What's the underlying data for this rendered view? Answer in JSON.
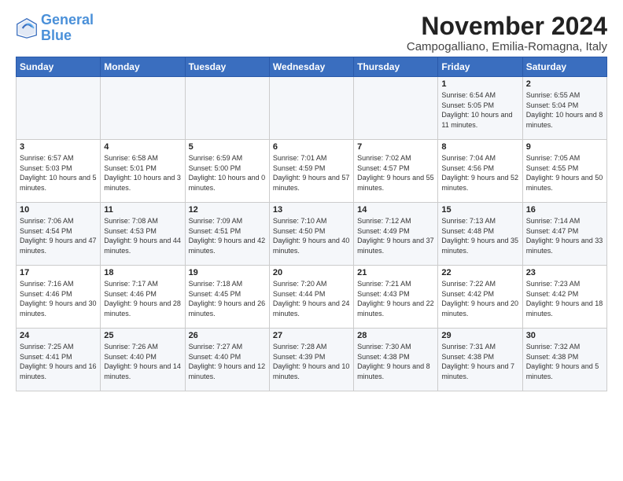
{
  "logo": {
    "text1": "General",
    "text2": "Blue"
  },
  "title": "November 2024",
  "subtitle": "Campogalliano, Emilia-Romagna, Italy",
  "days_of_week": [
    "Sunday",
    "Monday",
    "Tuesday",
    "Wednesday",
    "Thursday",
    "Friday",
    "Saturday"
  ],
  "weeks": [
    [
      {
        "day": "",
        "info": ""
      },
      {
        "day": "",
        "info": ""
      },
      {
        "day": "",
        "info": ""
      },
      {
        "day": "",
        "info": ""
      },
      {
        "day": "",
        "info": ""
      },
      {
        "day": "1",
        "info": "Sunrise: 6:54 AM\nSunset: 5:05 PM\nDaylight: 10 hours and 11 minutes."
      },
      {
        "day": "2",
        "info": "Sunrise: 6:55 AM\nSunset: 5:04 PM\nDaylight: 10 hours and 8 minutes."
      }
    ],
    [
      {
        "day": "3",
        "info": "Sunrise: 6:57 AM\nSunset: 5:03 PM\nDaylight: 10 hours and 5 minutes."
      },
      {
        "day": "4",
        "info": "Sunrise: 6:58 AM\nSunset: 5:01 PM\nDaylight: 10 hours and 3 minutes."
      },
      {
        "day": "5",
        "info": "Sunrise: 6:59 AM\nSunset: 5:00 PM\nDaylight: 10 hours and 0 minutes."
      },
      {
        "day": "6",
        "info": "Sunrise: 7:01 AM\nSunset: 4:59 PM\nDaylight: 9 hours and 57 minutes."
      },
      {
        "day": "7",
        "info": "Sunrise: 7:02 AM\nSunset: 4:57 PM\nDaylight: 9 hours and 55 minutes."
      },
      {
        "day": "8",
        "info": "Sunrise: 7:04 AM\nSunset: 4:56 PM\nDaylight: 9 hours and 52 minutes."
      },
      {
        "day": "9",
        "info": "Sunrise: 7:05 AM\nSunset: 4:55 PM\nDaylight: 9 hours and 50 minutes."
      }
    ],
    [
      {
        "day": "10",
        "info": "Sunrise: 7:06 AM\nSunset: 4:54 PM\nDaylight: 9 hours and 47 minutes."
      },
      {
        "day": "11",
        "info": "Sunrise: 7:08 AM\nSunset: 4:53 PM\nDaylight: 9 hours and 44 minutes."
      },
      {
        "day": "12",
        "info": "Sunrise: 7:09 AM\nSunset: 4:51 PM\nDaylight: 9 hours and 42 minutes."
      },
      {
        "day": "13",
        "info": "Sunrise: 7:10 AM\nSunset: 4:50 PM\nDaylight: 9 hours and 40 minutes."
      },
      {
        "day": "14",
        "info": "Sunrise: 7:12 AM\nSunset: 4:49 PM\nDaylight: 9 hours and 37 minutes."
      },
      {
        "day": "15",
        "info": "Sunrise: 7:13 AM\nSunset: 4:48 PM\nDaylight: 9 hours and 35 minutes."
      },
      {
        "day": "16",
        "info": "Sunrise: 7:14 AM\nSunset: 4:47 PM\nDaylight: 9 hours and 33 minutes."
      }
    ],
    [
      {
        "day": "17",
        "info": "Sunrise: 7:16 AM\nSunset: 4:46 PM\nDaylight: 9 hours and 30 minutes."
      },
      {
        "day": "18",
        "info": "Sunrise: 7:17 AM\nSunset: 4:46 PM\nDaylight: 9 hours and 28 minutes."
      },
      {
        "day": "19",
        "info": "Sunrise: 7:18 AM\nSunset: 4:45 PM\nDaylight: 9 hours and 26 minutes."
      },
      {
        "day": "20",
        "info": "Sunrise: 7:20 AM\nSunset: 4:44 PM\nDaylight: 9 hours and 24 minutes."
      },
      {
        "day": "21",
        "info": "Sunrise: 7:21 AM\nSunset: 4:43 PM\nDaylight: 9 hours and 22 minutes."
      },
      {
        "day": "22",
        "info": "Sunrise: 7:22 AM\nSunset: 4:42 PM\nDaylight: 9 hours and 20 minutes."
      },
      {
        "day": "23",
        "info": "Sunrise: 7:23 AM\nSunset: 4:42 PM\nDaylight: 9 hours and 18 minutes."
      }
    ],
    [
      {
        "day": "24",
        "info": "Sunrise: 7:25 AM\nSunset: 4:41 PM\nDaylight: 9 hours and 16 minutes."
      },
      {
        "day": "25",
        "info": "Sunrise: 7:26 AM\nSunset: 4:40 PM\nDaylight: 9 hours and 14 minutes."
      },
      {
        "day": "26",
        "info": "Sunrise: 7:27 AM\nSunset: 4:40 PM\nDaylight: 9 hours and 12 minutes."
      },
      {
        "day": "27",
        "info": "Sunrise: 7:28 AM\nSunset: 4:39 PM\nDaylight: 9 hours and 10 minutes."
      },
      {
        "day": "28",
        "info": "Sunrise: 7:30 AM\nSunset: 4:38 PM\nDaylight: 9 hours and 8 minutes."
      },
      {
        "day": "29",
        "info": "Sunrise: 7:31 AM\nSunset: 4:38 PM\nDaylight: 9 hours and 7 minutes."
      },
      {
        "day": "30",
        "info": "Sunrise: 7:32 AM\nSunset: 4:38 PM\nDaylight: 9 hours and 5 minutes."
      }
    ]
  ]
}
